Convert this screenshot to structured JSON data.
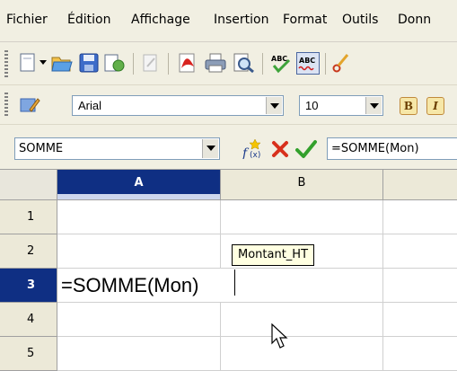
{
  "menubar": {
    "items": [
      "Fichier",
      "Édition",
      "Affichage",
      "Insertion",
      "Format",
      "Outils",
      "Donn"
    ]
  },
  "toolbar2": {
    "font_name": "Arial",
    "font_size": "10",
    "bold_label": "B",
    "italic_label": "I"
  },
  "formula_bar": {
    "name_box": "SOMME",
    "input": "=SOMME(Mon)"
  },
  "grid": {
    "columns": [
      "A",
      "B"
    ],
    "rows": [
      "1",
      "2",
      "3",
      "4",
      "5"
    ],
    "active_cell_text": "=SOMME(Mon)",
    "tooltip": "Montant_HT"
  },
  "colors": {
    "selection_header": "#0f2f83",
    "toolbar_bg": "#f1efe2",
    "tooltip_bg": "#ffffe1"
  },
  "icons": [
    "new-document-icon",
    "open-folder-icon",
    "save-icon",
    "edit-file-icon",
    "pdf-export-icon",
    "print-icon",
    "print-preview-icon",
    "spellcheck-icon",
    "autospellcheck-icon",
    "cut-icon",
    "styles-icon",
    "function-wizard-icon",
    "cancel-icon",
    "accept-icon"
  ]
}
